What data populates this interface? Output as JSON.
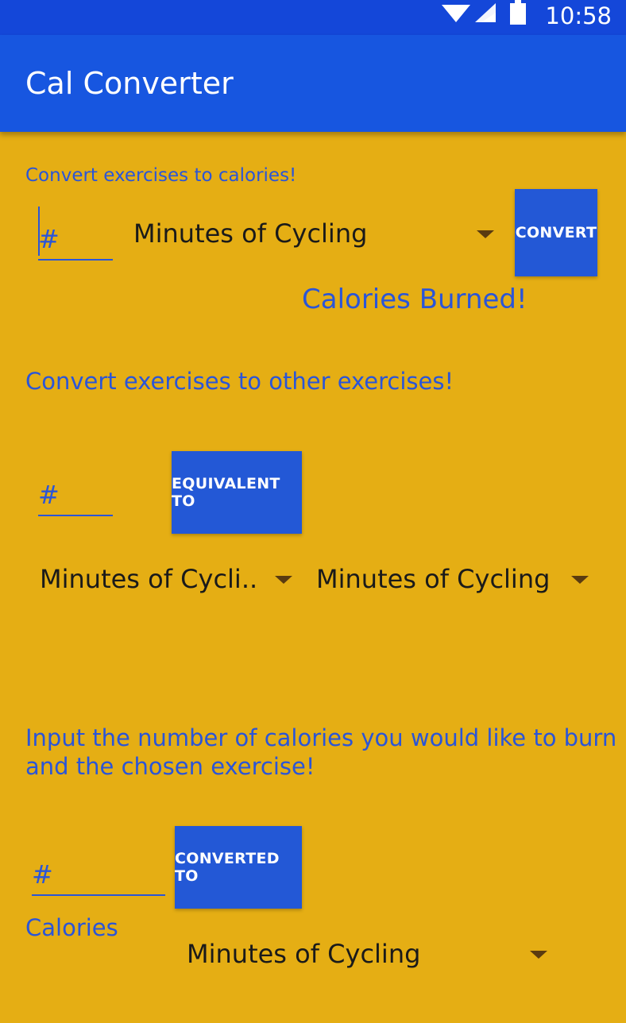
{
  "status_bar": {
    "time": "10:58",
    "icons": [
      "wifi-icon",
      "signal-icon",
      "battery-icon"
    ]
  },
  "app_bar": {
    "title": "Cal Converter"
  },
  "section1": {
    "heading": "Convert exercises to calories!",
    "input_placeholder": "#",
    "exercise_select": "Minutes of Cycling",
    "convert_button": "CONVERT",
    "result": "Calories Burned!"
  },
  "section2": {
    "heading": "Convert exercises to other exercises!",
    "input_placeholder": "#",
    "equivalent_button": "EQUIVALENT TO",
    "from_select": "Minutes of Cycli..",
    "to_select": "Minutes of Cycling"
  },
  "section3": {
    "heading_line1": "Input the number of calories you would like to burn",
    "heading_line2": "and the chosen exercise!",
    "input_placeholder": "#",
    "converted_button": "CONVERTED TO",
    "calories_label": "Calories",
    "exercise_select": "Minutes of Cycling"
  },
  "colors": {
    "background": "#E5AE14",
    "app_bar": "#1756E0",
    "status_bar": "#1447D9",
    "accent": "#2A55D8",
    "button": "#2358D6"
  }
}
